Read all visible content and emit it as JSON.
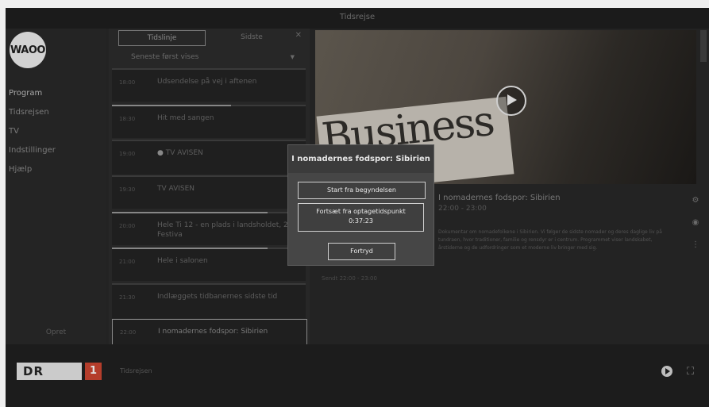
{
  "app": {
    "title": "Tidsrejse"
  },
  "sidebar": {
    "logo": "WAOO",
    "items": [
      {
        "label": "Program"
      },
      {
        "label": "Tidsrejsen"
      },
      {
        "label": "TV"
      },
      {
        "label": "Indstillinger"
      },
      {
        "label": "Hjælp"
      }
    ],
    "bottom": "Opret"
  },
  "list": {
    "tabs": [
      "Tidslinje",
      "Sidste"
    ],
    "close_icon": "close-icon",
    "dropdown_label": "Seneste først vises",
    "items": [
      {
        "time": "18:00",
        "name": "Udsendelse på vej i aftenen"
      },
      {
        "time": "18:30",
        "name": "Hit med sangen"
      },
      {
        "time": "19:00",
        "name": "TV AVISEN",
        "dot": true
      },
      {
        "time": "19:30",
        "name": "TV AVISEN"
      },
      {
        "time": "20:00",
        "name": "Hele Ti 12 - en plads i landsholdet, 2 Festiva"
      },
      {
        "time": "21:00",
        "name": "Hele i salonen"
      },
      {
        "time": "21:30",
        "name": "Indlæggets tidbanernes sidste tid"
      },
      {
        "time": "22:00",
        "name": "I nomadernes fodspor: Sibirien"
      }
    ]
  },
  "preview": {
    "image_text": "Business",
    "play_icon": "play-icon"
  },
  "details": {
    "title": "I nomadernes fodspor: Sibirien",
    "meta": "22:00 - 23:00",
    "description": "Dokumentar om nomadefolkene i Sibirien. Vi følger de sidste nomader og deres daglige liv på tundraen, hvor traditioner, familie og rensdyr er i centrum. Programmet viser landskabet, årstiderne og de udfordringer som et moderne liv bringer med sig.",
    "date": "Sendt 22:00 - 23:00"
  },
  "dialog": {
    "title": "I nomadernes fodspor: Sibirien",
    "start_label": "Start fra begyndelsen",
    "resume_label_line1": "Fortsæt fra optagetidspunkt",
    "resume_label_line2": "0:37:23",
    "cancel_label": "Fortryd"
  },
  "footer": {
    "channel_logo": "DR",
    "channel_number": "1",
    "now_playing": "Tidsrejsen"
  }
}
